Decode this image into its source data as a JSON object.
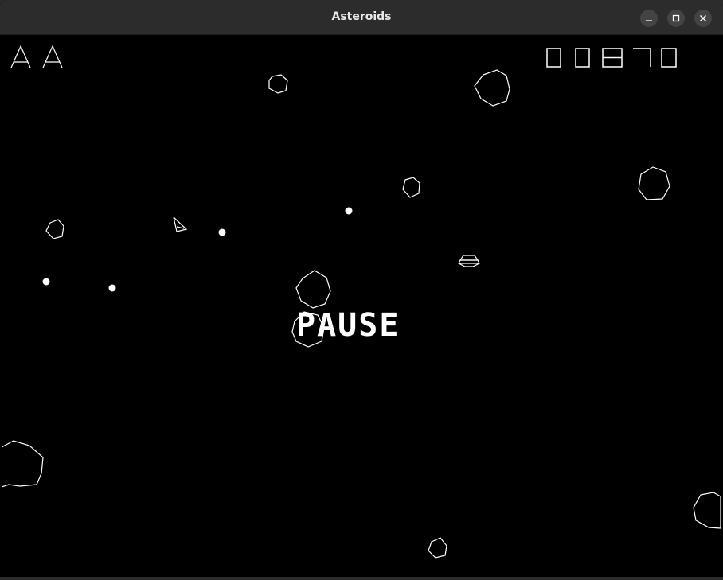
{
  "window": {
    "title": "Asteroids",
    "minimize_icon": "minimize-icon",
    "maximize_icon": "maximize-icon",
    "close_icon": "close-icon"
  },
  "game": {
    "lives_remaining": 2,
    "score": "00870",
    "status_text": "PAUSE",
    "colors": {
      "background": "#000000",
      "foreground": "#ffffff",
      "titlebar": "#2c2c2c"
    }
  }
}
